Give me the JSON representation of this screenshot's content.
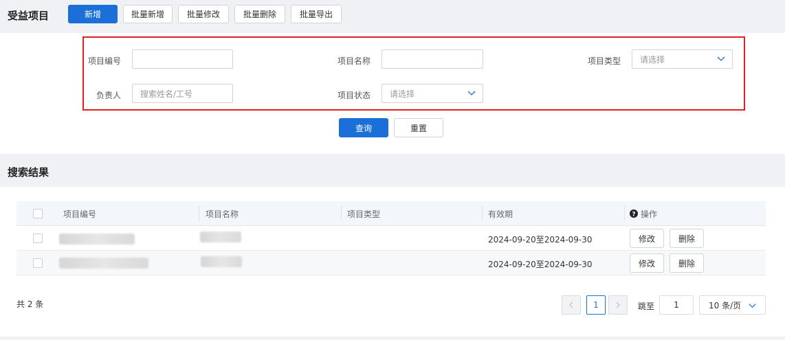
{
  "header": {
    "title": "受益项目",
    "buttons": {
      "add": "新增",
      "batch_add": "批量新增",
      "batch_edit": "批量修改",
      "batch_delete": "批量删除",
      "batch_export": "批量导出"
    }
  },
  "form": {
    "project_code_label": "项目编号",
    "project_code_value": "",
    "project_name_label": "项目名称",
    "project_name_value": "",
    "project_type_label": "项目类型",
    "project_type_placeholder": "请选择",
    "owner_label": "负责人",
    "owner_placeholder": "搜索姓名/工号",
    "project_status_label": "项目状态",
    "project_status_placeholder": "请选择",
    "query_button": "查询",
    "reset_button": "重置"
  },
  "results": {
    "title": "搜索结果",
    "columns": [
      "项目编号",
      "项目名称",
      "项目类型",
      "有效期",
      "操作"
    ],
    "rows": [
      {
        "code": "",
        "name": "",
        "type": "",
        "validity": "2024-09-20至2024-09-30"
      },
      {
        "code": "",
        "name": "",
        "type": "",
        "validity": "2024-09-20至2024-09-30"
      }
    ],
    "edit_label": "修改",
    "delete_label": "删除"
  },
  "pagination": {
    "total": "共 2 条",
    "current_page": "1",
    "jump_label": "跳至",
    "jump_value": "1",
    "page_size": "10 条/页"
  },
  "colors": {
    "primary": "#1a6fd8",
    "highlight_border": "#e31e24"
  },
  "icons": [
    "chevron-down-icon",
    "chevron-left-icon",
    "chevron-right-icon",
    "help-icon",
    "checkbox-icon"
  ]
}
